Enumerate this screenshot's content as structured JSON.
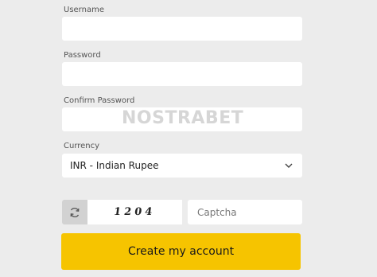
{
  "form": {
    "username_label": "Username",
    "password_label": "Password",
    "confirm_password_label": "Confirm Password",
    "currency_label": "Currency",
    "currency_value": "INR - Indian Rupee",
    "captcha_code": "1204",
    "captcha_placeholder": "Captcha",
    "submit_label": "Create my account"
  },
  "watermark": "NOSTRABET",
  "colors": {
    "background": "#ececec",
    "field": "#ffffff",
    "submit": "#f6c400"
  }
}
